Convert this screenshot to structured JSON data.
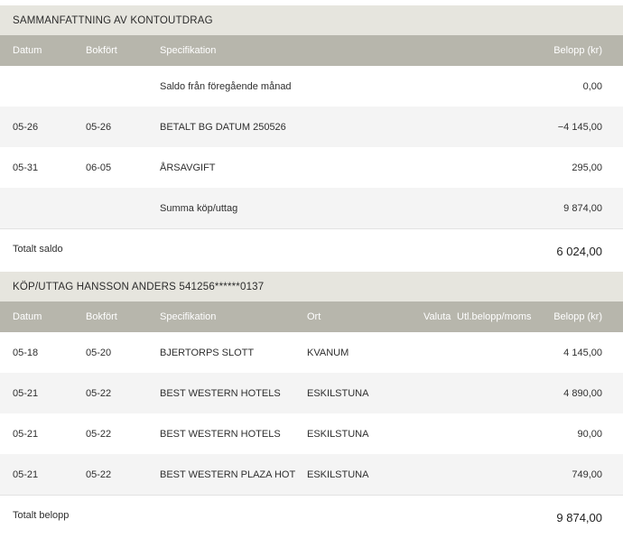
{
  "summary": {
    "title": "SAMMANFATTNING AV KONTOUTDRAG",
    "headers": {
      "date": "Datum",
      "booked": "Bokfört",
      "spec": "Specifikation",
      "amount": "Belopp (kr)"
    },
    "rows": [
      {
        "date": "",
        "booked": "",
        "spec": "Saldo från föregående månad",
        "amount": "0,00"
      },
      {
        "date": "05-26",
        "booked": "05-26",
        "spec": "BETALT BG DATUM 250526",
        "amount": "−4 145,00"
      },
      {
        "date": "05-31",
        "booked": "06-05",
        "spec": "ÅRSAVGIFT",
        "amount": "295,00"
      },
      {
        "date": "",
        "booked": "",
        "spec": "Summa köp/uttag",
        "amount": "9 874,00"
      }
    ],
    "total_label": "Totalt saldo",
    "total_value": "6 024,00"
  },
  "purchases": {
    "title": "KÖP/UTTAG HANSSON ANDERS 541256******0137",
    "headers": {
      "date": "Datum",
      "booked": "Bokfört",
      "spec": "Specifikation",
      "place": "Ort",
      "currency": "Valuta",
      "foreign": "Utl.belopp/moms",
      "amount": "Belopp (kr)"
    },
    "rows": [
      {
        "date": "05-18",
        "booked": "05-20",
        "spec": "BJERTORPS SLOTT",
        "place": "KVANUM",
        "amount": "4 145,00"
      },
      {
        "date": "05-21",
        "booked": "05-22",
        "spec": "BEST WESTERN HOTELS",
        "place": "ESKILSTUNA",
        "amount": "4 890,00"
      },
      {
        "date": "05-21",
        "booked": "05-22",
        "spec": "BEST WESTERN HOTELS",
        "place": "ESKILSTUNA",
        "amount": "90,00"
      },
      {
        "date": "05-21",
        "booked": "05-22",
        "spec": "BEST WESTERN PLAZA HOT",
        "place": "ESKILSTUNA",
        "amount": "749,00"
      }
    ],
    "total_label": "Totalt belopp",
    "total_value": "9 874,00"
  }
}
